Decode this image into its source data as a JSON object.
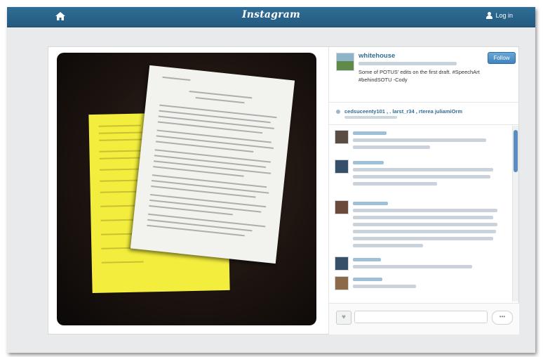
{
  "topbar": {
    "brand": "Instagram",
    "login_label": "Log in"
  },
  "post": {
    "username": "whitehouse",
    "follow_label": "Follow",
    "caption": "Some of POTUS' edits on the first draft. #SpeechArt #behindSOTU -Cody",
    "likes_line": "cedsuceenty101 , . larst_r34 , rterea juliamiOrm"
  },
  "icons": {
    "home": "home-icon",
    "user": "user-icon",
    "heart": "heart-icon",
    "more": "ellipsis-icon"
  },
  "colors": {
    "topbar": "#2f6d96",
    "accent": "#3f84bd",
    "link": "#2f6d96",
    "background": "#e9eaeb"
  }
}
